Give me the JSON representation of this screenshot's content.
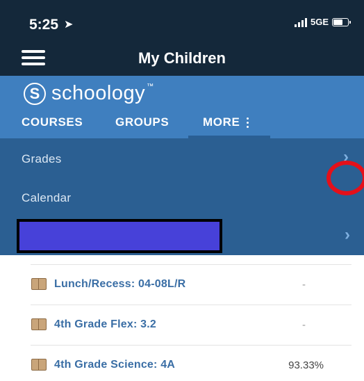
{
  "status_bar": {
    "time": "5:25",
    "location_icon": "location-arrow-icon",
    "network": "5GE"
  },
  "nav": {
    "title": "My Children",
    "menu_icon": "hamburger-icon"
  },
  "brand": {
    "logo_letter": "S",
    "name": "schoology",
    "trademark": "™"
  },
  "tabs": [
    {
      "label": "COURSES"
    },
    {
      "label": "GROUPS"
    },
    {
      "label": "MORE"
    }
  ],
  "dropdown": {
    "items": [
      {
        "label": "Grades"
      },
      {
        "label": "Calendar"
      }
    ],
    "chevron": "›"
  },
  "courses": [
    {
      "name": "Lunch/Recess: 04-08L/R",
      "grade": "-"
    },
    {
      "name": "4th Grade Flex: 3.2",
      "grade": "-"
    },
    {
      "name": "4th Grade Science: 4A",
      "grade": "93.33%"
    }
  ],
  "colors": {
    "dark_header": "#14283a",
    "brand_blue": "#3f7fbf",
    "dropdown_blue": "#2b5f92",
    "highlight_red": "#e4101a",
    "redacted": "#4741d9",
    "link_blue": "#3a6ea5"
  }
}
